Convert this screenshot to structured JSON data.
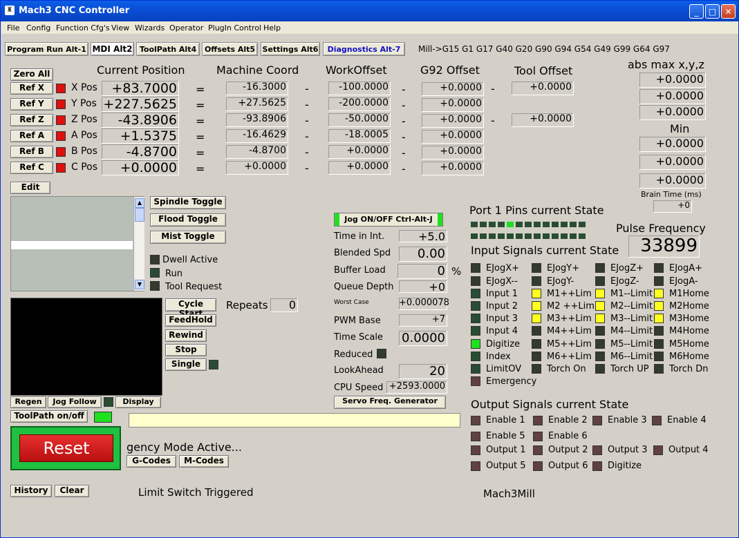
{
  "window": {
    "title": "Mach3 CNC Controller"
  },
  "menu": [
    "File",
    "Config",
    "Function Cfg's",
    "View",
    "Wizards",
    "Operator",
    "PlugIn Control",
    "Help"
  ],
  "tabs": [
    "Program Run Alt-1",
    "MDI Alt2",
    "ToolPath Alt4",
    "Offsets Alt5",
    "Settings Alt6",
    "Diagnostics Alt-7"
  ],
  "gcodes": "Mill->G15  G1 G17 G40 G20 G90 G94 G54 G49 G99 G64 G97",
  "headers": {
    "current": "Current Position",
    "machine": "Machine Coord",
    "work": "WorkOffset",
    "g92": "G92 Offset",
    "tool": "Tool Offset",
    "absmax": "abs max x,y,z",
    "min": "Min",
    "brain": "Brain Time (ms)"
  },
  "zero_all": "Zero All",
  "axes": [
    {
      "ref": "Ref X",
      "label": "X Pos",
      "pos": "+83.7000",
      "mach": "-16.3000",
      "work": "-100.0000",
      "g92": "+0.0000"
    },
    {
      "ref": "Ref Y",
      "label": "Y Pos",
      "pos": "+227.5625",
      "mach": "+27.5625",
      "work": "-200.0000",
      "g92": "+0.0000"
    },
    {
      "ref": "Ref Z",
      "label": "Z Pos",
      "pos": "-43.8906",
      "mach": "-93.8906",
      "work": "-50.0000",
      "g92": "+0.0000"
    },
    {
      "ref": "Ref A",
      "label": "A Pos",
      "pos": "+1.5375",
      "mach": "-16.4629",
      "work": "-18.0005",
      "g92": "+0.0000"
    },
    {
      "ref": "Ref B",
      "label": "B Pos",
      "pos": "-4.8700",
      "mach": "-4.8700",
      "work": "+0.0000",
      "g92": "+0.0000"
    },
    {
      "ref": "Ref C",
      "label": "C Pos",
      "pos": "+0.0000",
      "mach": "+0.0000",
      "work": "+0.0000",
      "g92": "+0.0000"
    }
  ],
  "ops": {
    "eq": "=",
    "minus": "-"
  },
  "tool_offsets": [
    "+0.0000",
    "+0.0000"
  ],
  "absmax": [
    "+0.0000",
    "+0.0000",
    "+0.0000"
  ],
  "min": [
    "+0.0000",
    "+0.0000",
    "+0.0000"
  ],
  "brain_time": "+0",
  "edit": "Edit",
  "toggles": [
    "Spindle Toggle",
    "Flood Toggle",
    "Mist Toggle"
  ],
  "status_leds": [
    "Dwell Active",
    "Run",
    "Tool Request"
  ],
  "cycle": {
    "start": "Cycle Start",
    "feedhold": "FeedHold",
    "rewind": "Rewind",
    "stop": "Stop",
    "single": "Single",
    "repeats_label": "Repeats",
    "repeats": "0"
  },
  "bottom_btns": {
    "regen": "Regen",
    "jogfollow": "Jog Follow",
    "display": "Display",
    "toolpath": "ToolPath on/off",
    "reset": "Reset",
    "gcodes": "G-Codes",
    "mcodes": "M-Codes",
    "history": "History",
    "clear": "Clear"
  },
  "messages": {
    "emergency": "gency Mode Active...",
    "limit": "Limit Switch Triggered",
    "profile": "Mach3Mill"
  },
  "jog": "Jog ON/OFF Ctrl-Alt-J",
  "stats": [
    {
      "label": "Time in Int.",
      "value": "+5.0"
    },
    {
      "label": "Blended Spd",
      "value": "0.00"
    },
    {
      "label": "Buffer Load",
      "value": "0",
      "unit": "%"
    },
    {
      "label": "Queue Depth",
      "value": "+0"
    },
    {
      "label": "Worst Case",
      "value": "+0.000078"
    },
    {
      "label": "PWM Base",
      "value": "+7"
    },
    {
      "label": "Time Scale",
      "value": "0.0000"
    },
    {
      "label": "Reduced",
      "value": ""
    },
    {
      "label": "LookAhead",
      "value": "20"
    },
    {
      "label": "CPU Speed",
      "value": "+2593.0000"
    }
  ],
  "servo": "Servo Freq. Generator",
  "port": {
    "title": "Port 1 Pins current State",
    "pulse_label": "Pulse Frequency",
    "pulse": "33899"
  },
  "input_title": "Input Signals current State",
  "inputs": [
    [
      "EJogX+",
      "EJogY+",
      "EJogZ+",
      "EJogA+"
    ],
    [
      "EJogX--",
      "EJogY-",
      "EJogZ-",
      "EJogA-"
    ],
    [
      "Input 1",
      "M1++Lim",
      "M1--Limit",
      "M1Home"
    ],
    [
      "Input 2",
      "M2 ++Lim",
      "M2--Limit",
      "M2Home"
    ],
    [
      "Input 3",
      "M3++Lim",
      "M3--Limit",
      "M3Home"
    ],
    [
      "Input 4",
      "M4++Lim",
      "M4--Limit",
      "M4Home"
    ],
    [
      "Digitize",
      "M5++Lim",
      "M5--Limit",
      "M5Home"
    ],
    [
      "Index",
      "M6++Lim",
      "M6--Limit",
      "M6Home"
    ],
    [
      "LimitOV",
      "Torch On",
      "Torch UP",
      "Torch Dn"
    ],
    [
      "Emergency"
    ]
  ],
  "output_title": "Output Signals current State",
  "outputs": [
    [
      "Enable 1",
      "Enable 2",
      "Enable 3",
      "Enable 4"
    ],
    [
      "Enable 5",
      "Enable 6"
    ],
    [
      "Output 1",
      "Output 2",
      "Output 3",
      "Output 4"
    ],
    [
      "Output 5",
      "Output 6",
      "Digitize"
    ]
  ]
}
